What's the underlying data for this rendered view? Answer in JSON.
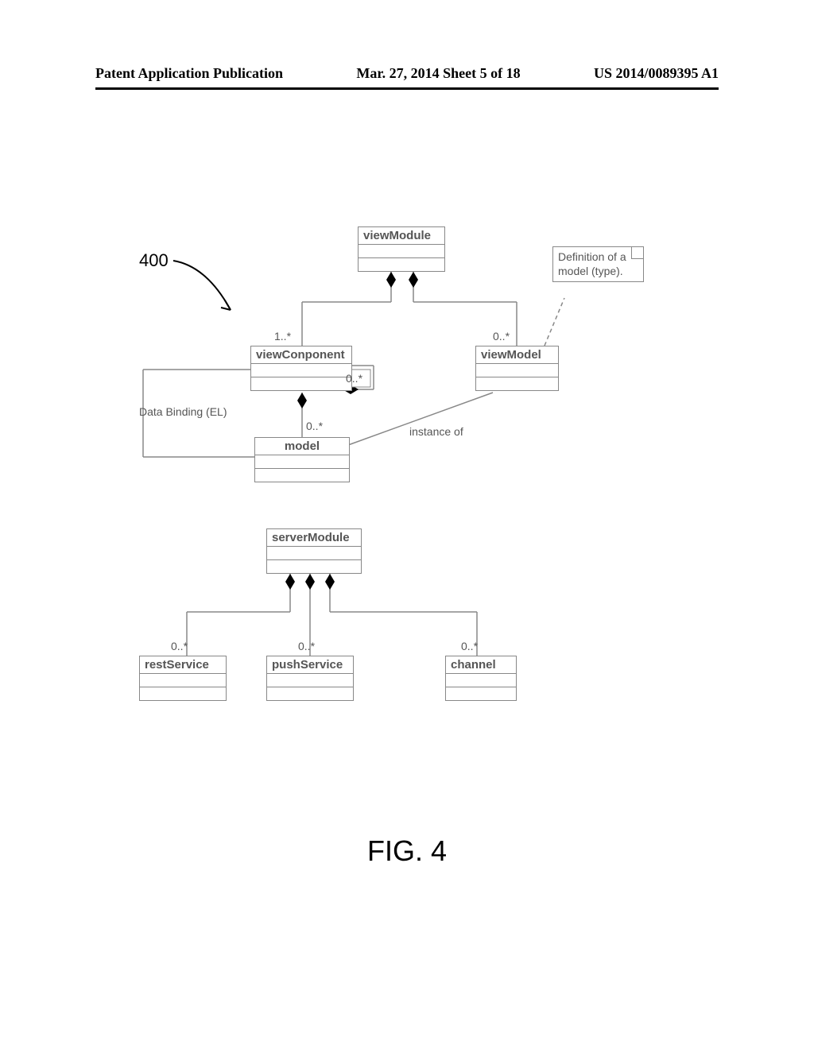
{
  "header": {
    "left": "Patent Application Publication",
    "center": "Mar. 27, 2014  Sheet 5 of 18",
    "right": "US 2014/0089395 A1"
  },
  "ref_num": "400",
  "figure_caption": "FIG. 4",
  "note_text": "Definition of a model (type).",
  "boxes": {
    "viewModule": "viewModule",
    "viewComponent": "viewConponent",
    "viewModel": "viewModel",
    "model": "model",
    "serverModule": "serverModule",
    "restService": "restService",
    "pushService": "pushService",
    "channel": "channel"
  },
  "multiplicity": {
    "one_many": "1..*",
    "zero_many": "0..*"
  },
  "labels": {
    "data_binding": "Data Binding (EL)",
    "instance_of": "instance of"
  }
}
